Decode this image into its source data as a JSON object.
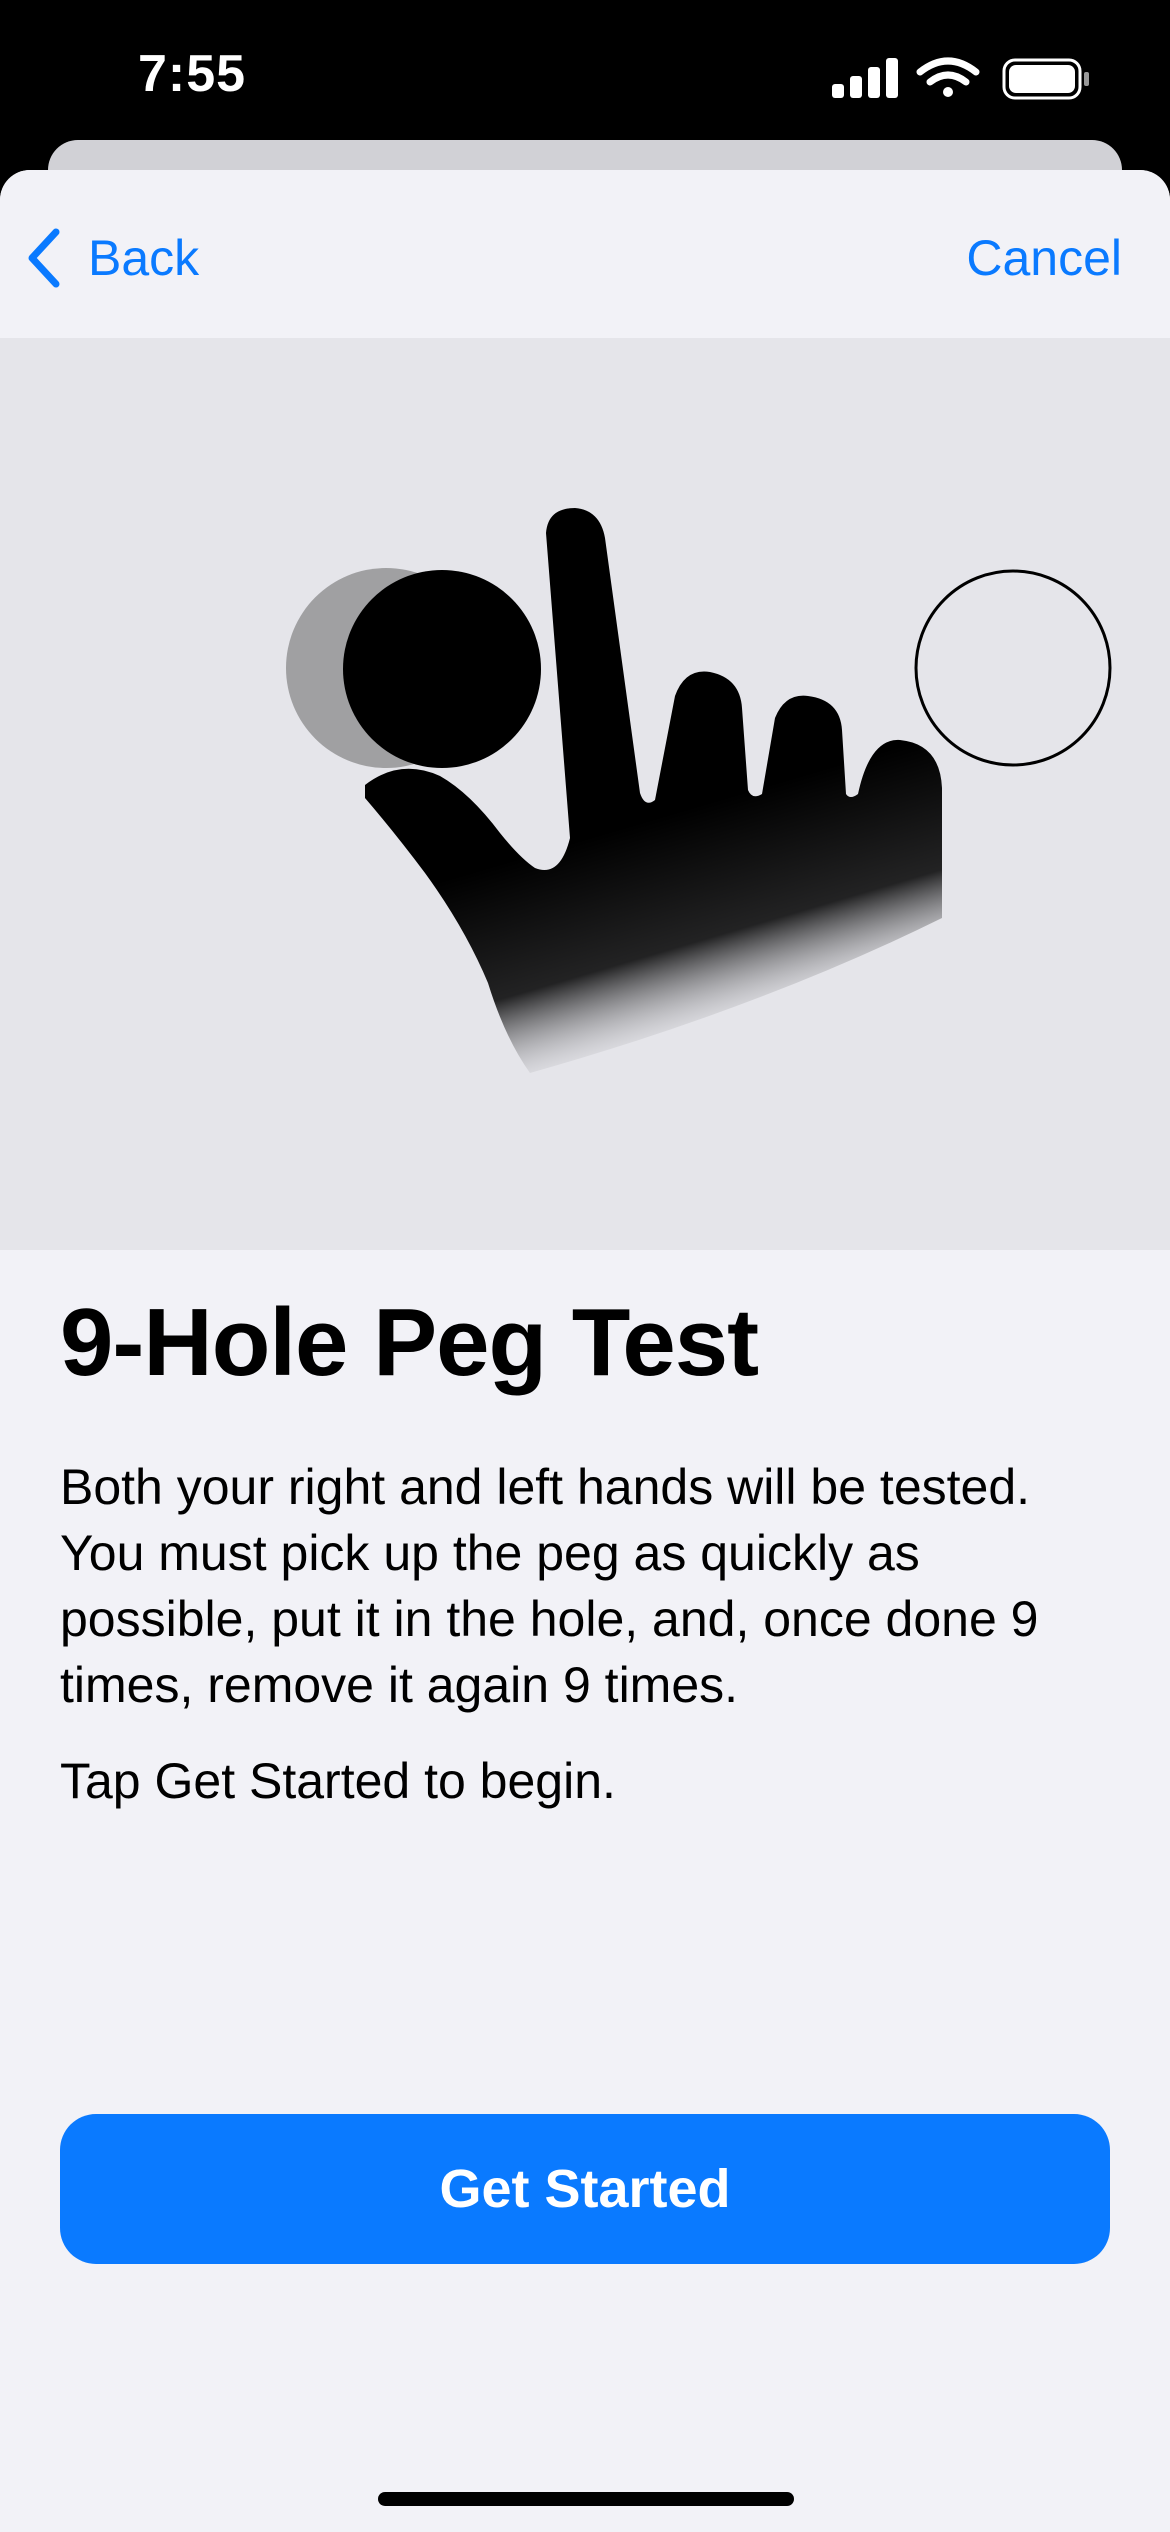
{
  "status_bar": {
    "time": "7:55",
    "icons": [
      "cellular-signal-icon",
      "wifi-icon",
      "battery-icon"
    ]
  },
  "nav": {
    "back_label": "Back",
    "cancel_label": "Cancel"
  },
  "illustration": {
    "description_icon": "hand-peg-illustration-icon"
  },
  "content": {
    "title": "9-Hole Peg Test",
    "paragraph1": "Both your right and left hands will be tested. You must pick up the peg as quickly as possible, put it in the hole, and, once done 9 times, remove it again 9 times.",
    "paragraph2": "Tap Get Started to begin."
  },
  "actions": {
    "primary_label": "Get Started"
  },
  "colors": {
    "accent": "#0a7aff",
    "sheet_background": "#f2f2f7",
    "illustration_background": "#e5e5ea"
  }
}
